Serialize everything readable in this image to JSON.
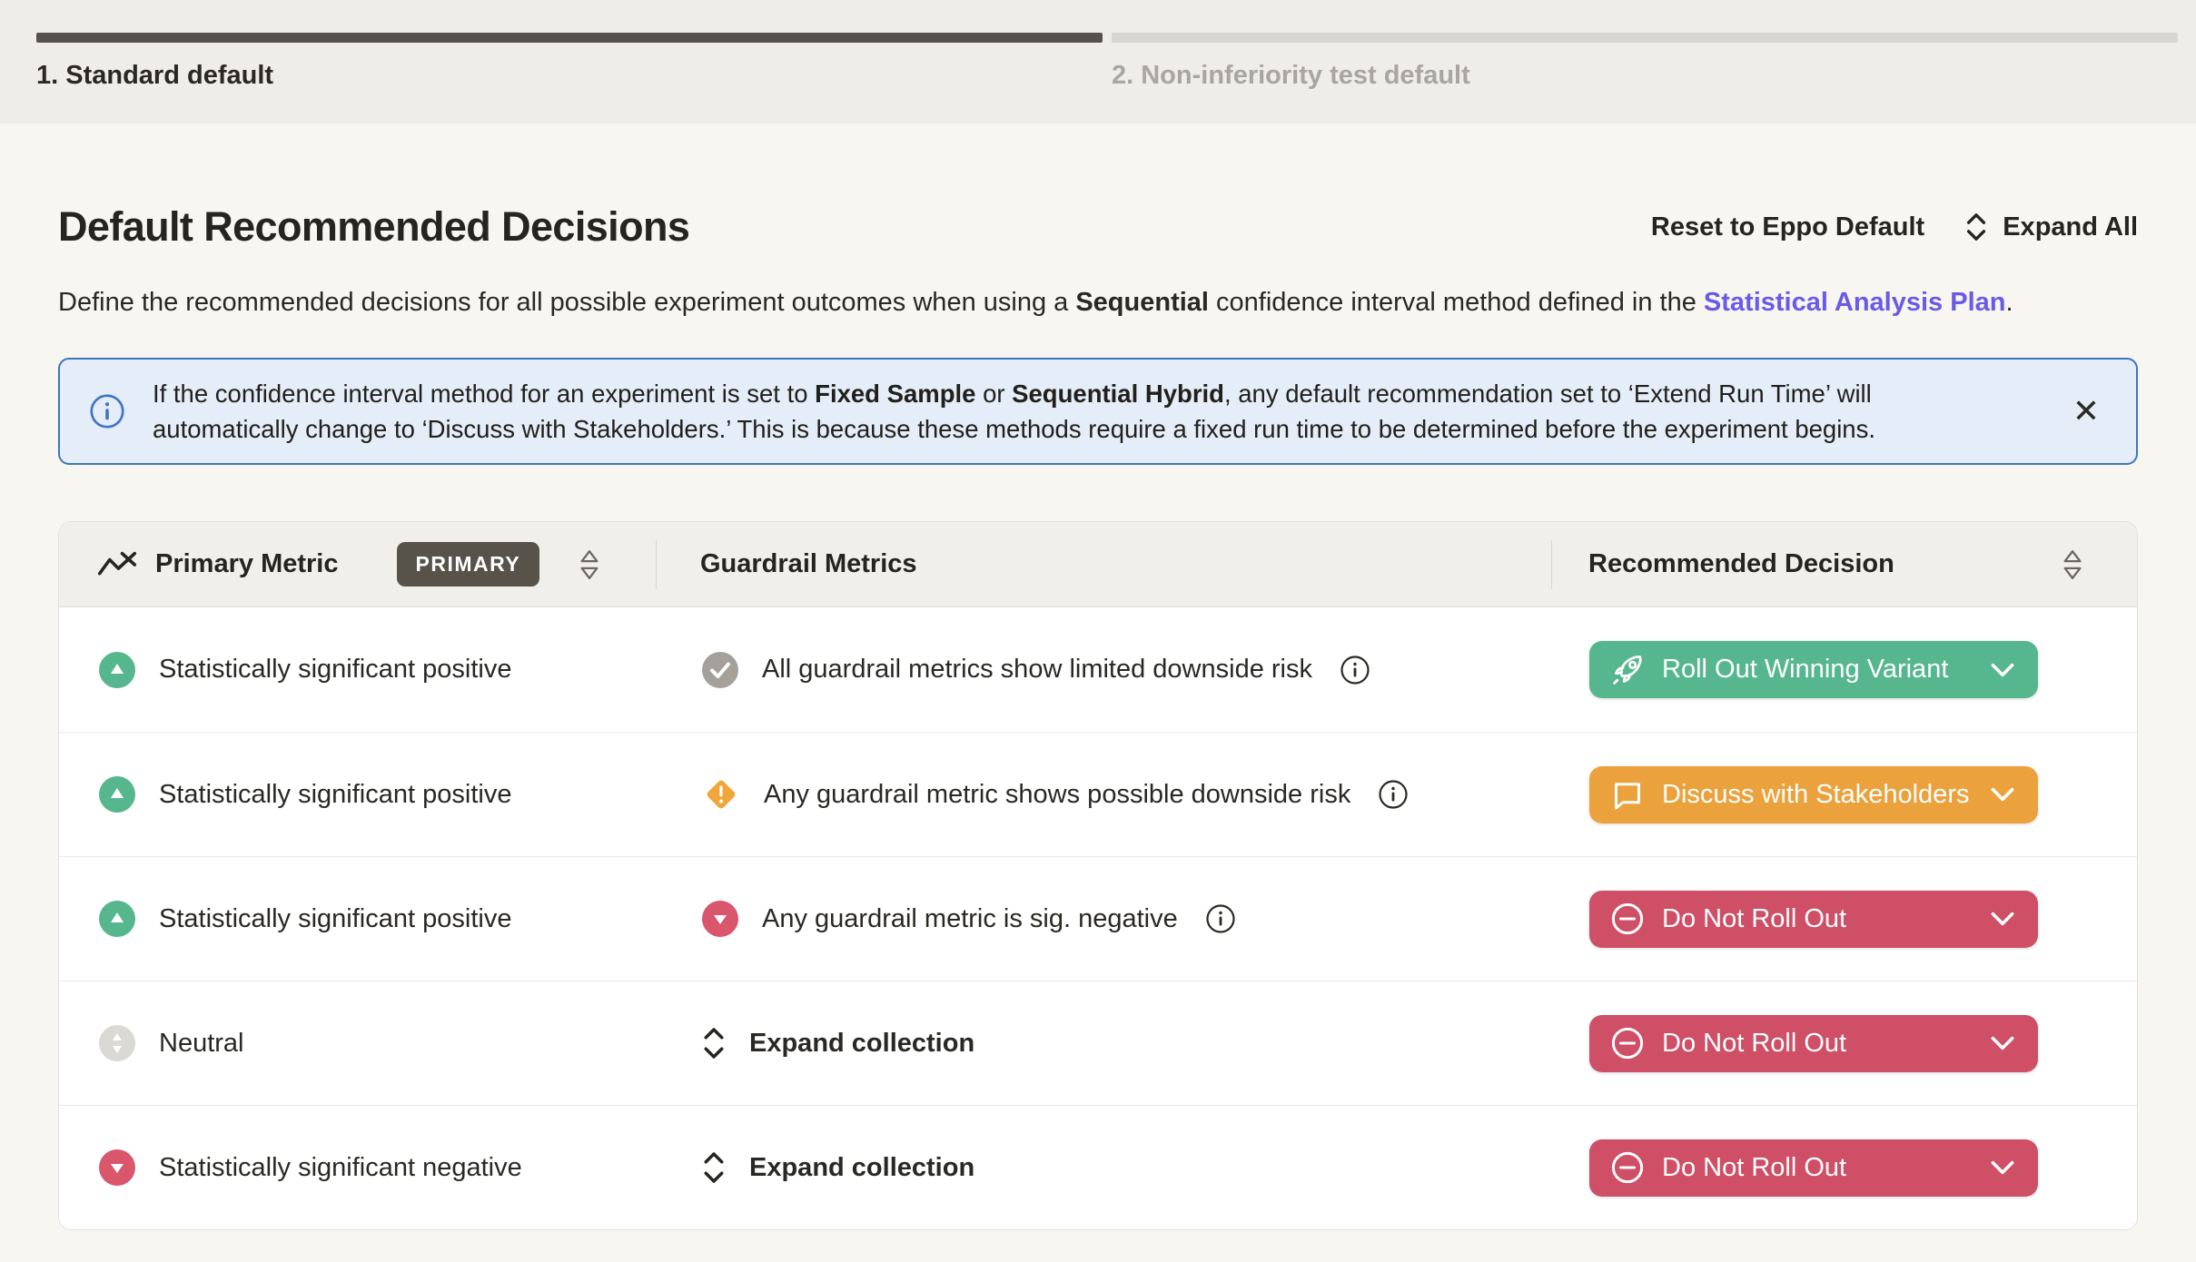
{
  "stepper": {
    "steps": [
      {
        "label": "1. Standard default",
        "active": true
      },
      {
        "label": "2. Non-inferiority test default",
        "active": false
      }
    ]
  },
  "page": {
    "title": "Default Recommended Decisions",
    "actions": {
      "reset": "Reset to Eppo Default",
      "expand_all": "Expand All"
    },
    "description": {
      "pre": "Define the recommended decisions for all possible experiment outcomes when using a ",
      "bold": "Sequential",
      "mid": " confidence interval method defined in the ",
      "link": "Statistical Analysis Plan",
      "end": "."
    }
  },
  "banner": {
    "pre": "If the confidence interval method for an experiment is set to ",
    "bold1": "Fixed Sample",
    "mid": " or ",
    "bold2": "Sequential Hybrid",
    "rest": ", any default recommendation set to ‘Extend Run Time’ will automatically change to ‘Discuss with Stakeholders.’ This is because these methods require a fixed run time to be determined before the experiment begins.",
    "close_icon": "✕"
  },
  "table": {
    "header": {
      "primary": "Primary Metric",
      "primary_badge": "PRIMARY",
      "guardrail": "Guardrail Metrics",
      "decision": "Recommended Decision"
    },
    "rows": [
      {
        "primary": "Statistically significant positive",
        "guardrail": "All guardrail metrics show limited downside risk",
        "decision": "Roll Out Winning Variant"
      },
      {
        "primary": "Statistically significant positive",
        "guardrail": "Any guardrail metric shows possible downside risk",
        "decision": "Discuss with Stakeholders"
      },
      {
        "primary": "Statistically significant positive",
        "guardrail": "Any guardrail metric is sig. negative",
        "decision": "Do Not Roll Out"
      },
      {
        "primary": "Neutral",
        "guardrail": "Expand collection",
        "decision": "Do Not Roll Out"
      },
      {
        "primary": "Statistically significant negative",
        "guardrail": "Expand collection",
        "decision": "Do Not Roll Out"
      }
    ]
  },
  "colors": {
    "positive_green": "#56B78E",
    "warning_orange": "#EBA23C",
    "negative_red": "#CE4F66",
    "neutral_gray": "#DBD9D4",
    "check_gray": "#A5A19A",
    "banner_blue": "#3F74C4",
    "link_purple": "#6A5AE8",
    "progress_dark": "#55524B",
    "badge_dark": "#57534B"
  }
}
